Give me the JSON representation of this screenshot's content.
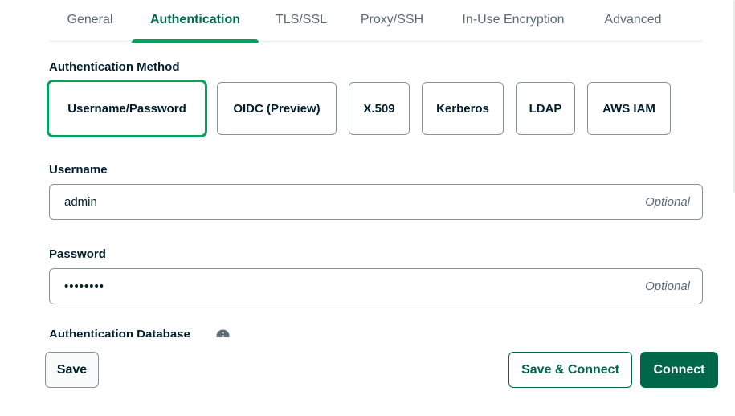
{
  "tabs": [
    {
      "label": "General"
    },
    {
      "label": "Authentication"
    },
    {
      "label": "TLS/SSL"
    },
    {
      "label": "Proxy/SSH"
    },
    {
      "label": "In-Use Encryption"
    },
    {
      "label": "Advanced"
    }
  ],
  "active_tab": "Authentication",
  "auth_method": {
    "label": "Authentication Method",
    "options": [
      {
        "label": "Username/Password"
      },
      {
        "label": "OIDC (Preview)"
      },
      {
        "label": "X.509"
      },
      {
        "label": "Kerberos"
      },
      {
        "label": "LDAP"
      },
      {
        "label": "AWS IAM"
      }
    ],
    "selected": "Username/Password"
  },
  "username": {
    "label": "Username",
    "value": "admin",
    "hint": "Optional"
  },
  "password": {
    "label": "Password",
    "value": "••••••••",
    "hint": "Optional"
  },
  "auth_database": {
    "label": "Authentication Database",
    "icon": "info-icon"
  },
  "footer": {
    "save_label": "Save",
    "save_connect_label": "Save & Connect",
    "connect_label": "Connect"
  },
  "colors": {
    "accent": "#00a35c",
    "primary": "#00684a",
    "text": "#001e2b",
    "muted": "#5c6c75",
    "border": "#889397"
  }
}
